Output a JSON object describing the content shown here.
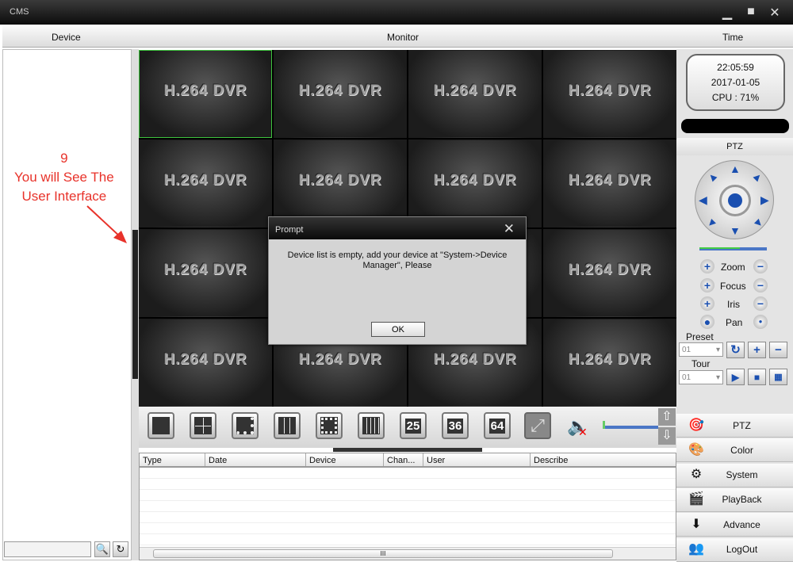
{
  "window": {
    "title": "CMS",
    "minimize": "▁",
    "maximize": "■",
    "close": "✕"
  },
  "header": {
    "device": "Device",
    "monitor": "Monitor",
    "time": "Time"
  },
  "annotation": {
    "step": "9",
    "line1": "You will See The",
    "line2": "User Interface"
  },
  "grid": {
    "cell_label": "H.264 DVR"
  },
  "dialog": {
    "title": "Prompt",
    "close": "✕",
    "message": "Device list is empty, add your device at \"System->Device Manager\", Please",
    "ok": "OK"
  },
  "status": {
    "time": "22:05:59",
    "date": "2017-01-05",
    "cpu": "CPU : 71%"
  },
  "ptz": {
    "title": "PTZ",
    "zoom": "Zoom",
    "focus": "Focus",
    "iris": "Iris",
    "pan": "Pan",
    "preset_label": "Preset",
    "preset_value": "01",
    "tour_label": "Tour",
    "tour_value": "01",
    "speed_percent": 60
  },
  "layouts": {
    "l25": "25",
    "l36": "36",
    "l64": "64"
  },
  "table": {
    "columns": [
      "Type",
      "Date",
      "Device",
      "Chan...",
      "User",
      "Describe"
    ],
    "scroll_grip": "III"
  },
  "menu": [
    {
      "label": "PTZ",
      "icon": "ptz-icon"
    },
    {
      "label": "Color",
      "icon": "color-icon"
    },
    {
      "label": "System",
      "icon": "system-icon"
    },
    {
      "label": "PlayBack",
      "icon": "playback-icon"
    },
    {
      "label": "Advance",
      "icon": "advance-icon"
    },
    {
      "label": "LogOut",
      "icon": "logout-icon"
    }
  ],
  "colors": {
    "accent": "#1a4fb0",
    "selected_cell": "#3ec43e",
    "annotation": "#e8322a"
  }
}
